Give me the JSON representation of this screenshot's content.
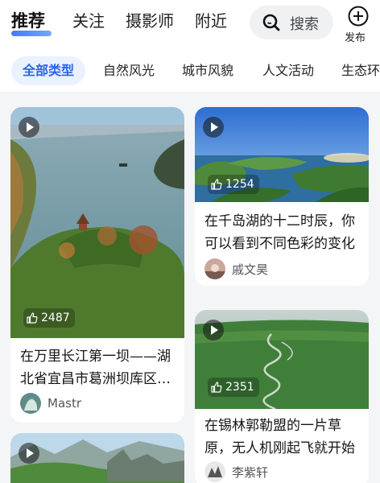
{
  "nav": {
    "tabs": [
      {
        "label": "推荐",
        "active": true
      },
      {
        "label": "关注",
        "active": false
      },
      {
        "label": "摄影师",
        "active": false
      },
      {
        "label": "附近",
        "active": false
      }
    ],
    "search_label": "搜索",
    "publish_label": "发布",
    "accent": "#2f6bff"
  },
  "categories": [
    {
      "label": "全部类型",
      "active": true
    },
    {
      "label": "自然风光",
      "active": false
    },
    {
      "label": "城市风貌",
      "active": false
    },
    {
      "label": "人文活动",
      "active": false
    },
    {
      "label": "生态环",
      "active": false
    }
  ],
  "cards": [
    {
      "title": "在万里长江第一坝——湖北省宜昌市葛洲坝库区的夹江中段，宜昌夷陵区",
      "likes": "2487",
      "author": "Mastr",
      "video": true
    },
    {
      "title": "在千岛湖的十二时辰，你可以看到不同色彩的变化",
      "likes": "1254",
      "author": "戚文昊",
      "video": true
    },
    {
      "title": "在锡林郭勒盟的一片草原，无人机刚起飞就开始",
      "likes": "2351",
      "author": "李紫轩",
      "video": true
    },
    {
      "title": "",
      "likes": "",
      "author": "",
      "video": true
    }
  ]
}
